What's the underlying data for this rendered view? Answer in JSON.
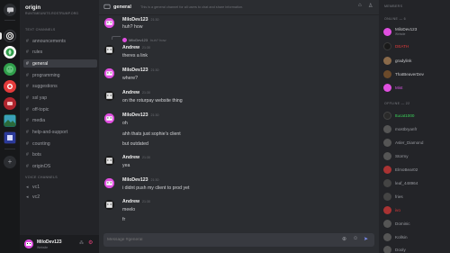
{
  "server": {
    "name": "origin",
    "subtitle": "RUNTIMEUNITS.ROSTRUMP.ORG"
  },
  "categories": {
    "text": "TEXT CHANNELS",
    "voice": "VOICE CHANNELS"
  },
  "text_channels": [
    {
      "label": "announcements"
    },
    {
      "label": "rules"
    },
    {
      "label": "general"
    },
    {
      "label": "programming"
    },
    {
      "label": "suggestions"
    },
    {
      "label": "ssl yap"
    },
    {
      "label": "off-topic"
    },
    {
      "label": "media"
    },
    {
      "label": "help-and-support"
    },
    {
      "label": "counting"
    },
    {
      "label": "bots"
    },
    {
      "label": "originOS"
    }
  ],
  "voice_channels": [
    {
      "label": "vc1"
    },
    {
      "label": "vc2"
    }
  ],
  "current_user": {
    "name": "MiloDev123",
    "status": "Website"
  },
  "header": {
    "channel": "general",
    "topic": "This is a general channel for all users to chat and share information."
  },
  "messages": {
    "m1": {
      "name": "MiloDev123",
      "time": "21:30",
      "text": "huh? how"
    },
    "m2": {
      "reply_name": "MiloDev123",
      "reply_text": "huh? how",
      "name": "Andrew",
      "time": "21:30",
      "text": "theres a link"
    },
    "m3": {
      "name": "MiloDev123",
      "time": "21:30",
      "text": "where?"
    },
    "m4": {
      "name": "Andrew",
      "time": "21:30",
      "text": "on the roturpay website thing"
    },
    "m5": {
      "name": "MiloDev123",
      "time": "21:30",
      "lines": [
        "oh",
        "ahh thats just sophie's client",
        "but outdated"
      ]
    },
    "m6": {
      "name": "Andrew",
      "time": "21:30",
      "text": "yea"
    },
    "m7": {
      "name": "MiloDev123",
      "time": "21:30",
      "text": "i didnt push my client to prod yet"
    },
    "m8": {
      "name": "Andrew",
      "time": "21:30",
      "lines": [
        "meelo",
        "fr"
      ]
    }
  },
  "composer": {
    "placeholder": "Message #general"
  },
  "members_header": "MEMBERS",
  "online_label": "ONLINE — 6",
  "offline_label": "OFFLINE — 22",
  "online": [
    {
      "name": "MiloDev123",
      "sub": "Website",
      "color": "#d9d9dc",
      "avatar": "#e04fe0"
    },
    {
      "name": "DEATH",
      "sub": "",
      "color": "#e33b3b",
      "avatar": "#1a1a1a"
    },
    {
      "name": "gradylink",
      "sub": "",
      "color": "#c9cacd",
      "avatar": "#8a6a4a"
    },
    {
      "name": "ThatBeaverDev",
      "sub": "",
      "color": "#c9cacd",
      "avatar": "#6b4a2a"
    },
    {
      "name": "Mist",
      "sub": "",
      "color": "#d455e0",
      "avatar": "#e04fe0"
    }
  ],
  "offline": [
    {
      "name": "ttucat1000",
      "color": "#3bd45a",
      "avatar": "#2a2a2a"
    },
    {
      "name": "mostbryanfr",
      "color": "#9a9ca2",
      "avatar": "#555"
    },
    {
      "name": "Asler_Diamond",
      "color": "#9a9ca2",
      "avatar": "#555"
    },
    {
      "name": "Stormy",
      "color": "#9a9ca2",
      "avatar": "#555"
    },
    {
      "name": "ElmoBear02",
      "color": "#9a9ca2",
      "avatar": "#a33"
    },
    {
      "name": "leaf_448964",
      "color": "#9a9ca2",
      "avatar": "#444"
    },
    {
      "name": "fries",
      "color": "#9a9ca2",
      "avatar": "#444"
    },
    {
      "name": "ivo",
      "color": "#e33b3b",
      "avatar": "#a33"
    },
    {
      "name": "Dominic",
      "color": "#9a9ca2",
      "avatar": "#555"
    },
    {
      "name": "Kollsin",
      "color": "#9a9ca2",
      "avatar": "#555"
    },
    {
      "name": "Dooly",
      "color": "#9a9ca2",
      "avatar": "#555"
    }
  ]
}
